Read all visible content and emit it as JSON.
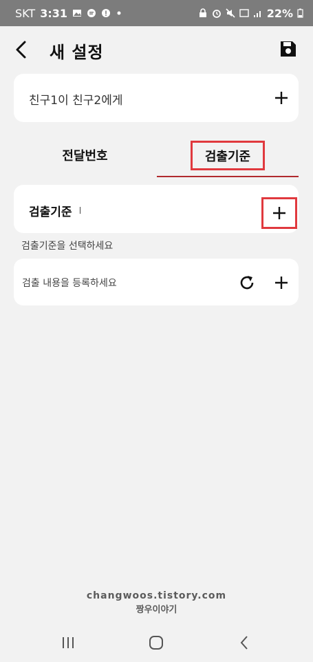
{
  "status_bar": {
    "carrier": "SKT",
    "time": "3:31",
    "battery": "22%",
    "icons_left": [
      "gallery-icon",
      "chat-icon",
      "alert-icon",
      "dot-icon"
    ],
    "icons_right": [
      "lock-icon",
      "alarm-icon",
      "mute-icon",
      "volte-icon",
      "signal-icon",
      "battery-icon"
    ]
  },
  "header": {
    "title": "새 설정",
    "back_icon": "chevron-left-icon",
    "save_icon": "floppy-disk-icon"
  },
  "recipient_card": {
    "text": "친구1이 친구2에게",
    "add_icon": "plus-icon"
  },
  "tabs": [
    {
      "label": "전달번호",
      "selected": false
    },
    {
      "label": "검출기준",
      "selected": true
    }
  ],
  "criteria_card": {
    "label": "검출기준",
    "add_icon": "plus-icon"
  },
  "hint": "검출기준을 선택하세요",
  "content_card": {
    "placeholder": "검출 내용을 등록하세요",
    "refresh_icon": "refresh-icon",
    "add_icon": "plus-icon"
  },
  "watermark": {
    "site": "changwoos.tistory.com",
    "name": "짱우이야기"
  },
  "nav_bar": {
    "items": [
      "recents-icon",
      "home-icon",
      "back-icon"
    ]
  },
  "colors": {
    "highlight": "#e0393e",
    "tab_underline": "#b02a2e",
    "background": "#f2f2f2",
    "status_bar": "#7c7c7c"
  }
}
